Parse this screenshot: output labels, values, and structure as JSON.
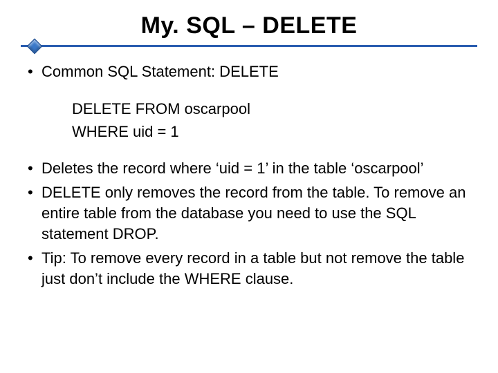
{
  "title": "My. SQL – DELETE",
  "bullet_intro": "Common SQL Statement: DELETE",
  "code": {
    "line1": "DELETE FROM oscarpool",
    "line2": "WHERE uid = 1"
  },
  "bullets": [
    "Deletes the record where ‘uid = 1’ in the table ‘oscarpool’",
    "DELETE only removes the record from the table. To remove an entire table from the database you need to use the SQL statement DROP.",
    "Tip: To remove every record in a table but not remove the table just don’t include the WHERE clause."
  ]
}
